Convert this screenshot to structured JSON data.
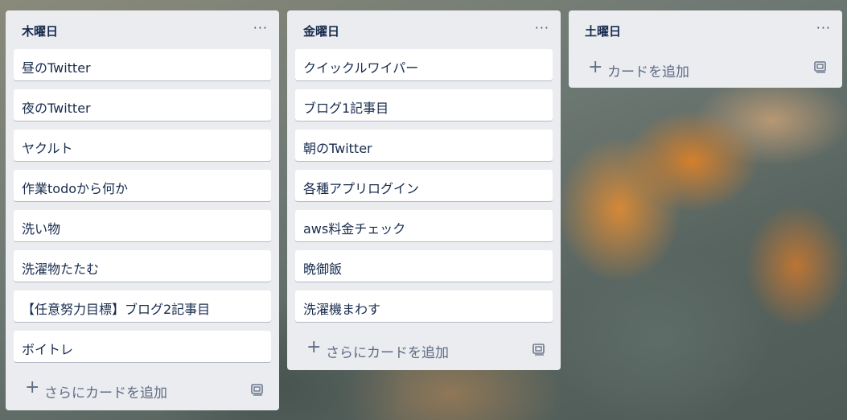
{
  "lists": [
    {
      "title": "木曜日",
      "menu": "···",
      "cards": [
        "昼のTwitter",
        "夜のTwitter",
        "ヤクルト",
        "作業todoから何か",
        "洗い物",
        "洗濯物たたむ",
        "【任意努力目標】ブログ2記事目",
        "ボイトレ"
      ],
      "add_label": "さらにカードを追加"
    },
    {
      "title": "金曜日",
      "menu": "···",
      "cards": [
        "クイックルワイパー",
        "ブログ1記事目",
        "朝のTwitter",
        "各種アプリログイン",
        "aws料金チェック",
        "晩御飯",
        "洗濯機まわす"
      ],
      "add_label": "さらにカードを追加"
    },
    {
      "title": "土曜日",
      "menu": "···",
      "cards": [],
      "add_label": "カードを追加"
    }
  ],
  "add_icon": "plus-icon",
  "template_icon": "card-template-icon"
}
